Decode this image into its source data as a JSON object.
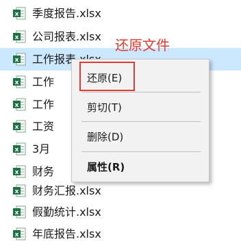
{
  "files": [
    {
      "name": "季度报告.xlsx",
      "icon": "excel-icon"
    },
    {
      "name": "公司报表.xlsx",
      "icon": "excel-icon"
    },
    {
      "name": "工作报表.xlsx",
      "icon": "excel-icon",
      "selected": true
    },
    {
      "name": "工作",
      "icon": "excel-icon"
    },
    {
      "name": "工作",
      "icon": "excel-icon"
    },
    {
      "name": "工资",
      "icon": "excel-icon"
    },
    {
      "name": "3月",
      "icon": "excel-icon"
    },
    {
      "name": "财务",
      "icon": "excel-icon"
    },
    {
      "name": "财务汇报.xlsx",
      "icon": "excel-icon"
    },
    {
      "name": "假勤统计.xlsx",
      "icon": "excel-icon"
    },
    {
      "name": "年底报告.xlsx",
      "icon": "excel-icon"
    }
  ],
  "annotation": "还原文件",
  "context_menu": {
    "restore": "还原(E)",
    "cut": "剪切(T)",
    "delete": "删除(D)",
    "properties": "属性(R)"
  },
  "colors": {
    "selection": "#cce8ff",
    "annotation_red": "#e8382c",
    "excel_green": "#1f7244"
  }
}
